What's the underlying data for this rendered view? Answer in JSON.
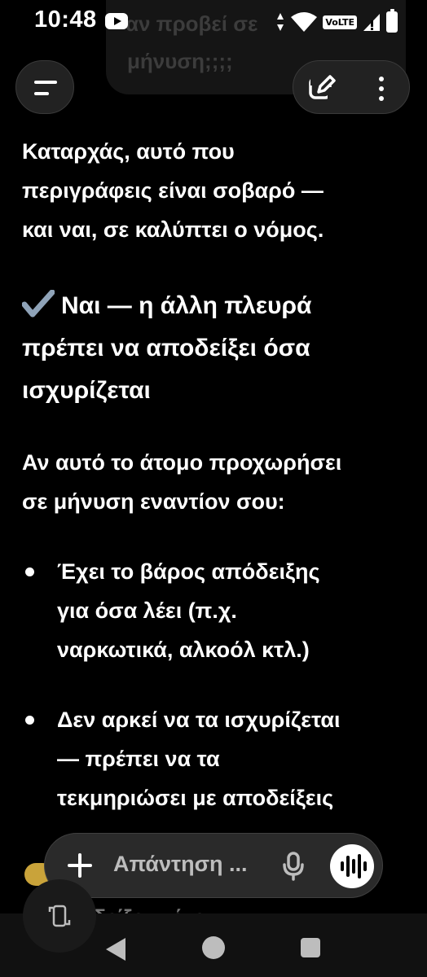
{
  "status_bar": {
    "time": "10:48",
    "network_badge": "VoLTE",
    "icons": [
      "youtube-icon",
      "data-arrows-icon",
      "wifi-icon",
      "signal-icon",
      "battery-icon"
    ]
  },
  "previous_message": {
    "line1": "αν προβεί σε",
    "line2": "μήνυση;;;;"
  },
  "header": {
    "menu_icon": "menu-icon",
    "edit_icon": "edit-icon",
    "more_icon": "more-vertical-icon"
  },
  "message": {
    "intro_lines": [
      "Καταρχάς, αυτό που",
      "περιγράφεις είναι σοβαρό —",
      "και ναι, σε καλύπτει ο νόμος."
    ],
    "heading_lines": [
      "Ναι — η άλλη πλευρά",
      "πρέπει να αποδείξει όσα",
      "ισχυρίζεται"
    ],
    "para_lines": [
      "Αν αυτό το άτομο προχωρήσει",
      "σε μήνυση εναντίον σου:"
    ],
    "bullet1": {
      "bold_line": "Έχει το βάρος απόδειξης",
      "lines": [
        "για όσα λέει (π.χ.",
        "ναρκωτικά, αλκοόλ κτλ.)"
      ]
    },
    "bullet2": {
      "lines": [
        "Δεν αρκεί να τα ισχυρίζεται",
        "— πρέπει να τα",
        "τεκμηριώσει με αποδείξεις"
      ]
    },
    "partial_line": "δείξει, τότε:"
  },
  "input": {
    "placeholder": "Απάντηση ..."
  },
  "colors": {
    "background": "#000000",
    "surface": "#2a2a2a",
    "check_accent": "#8fa3b8"
  }
}
